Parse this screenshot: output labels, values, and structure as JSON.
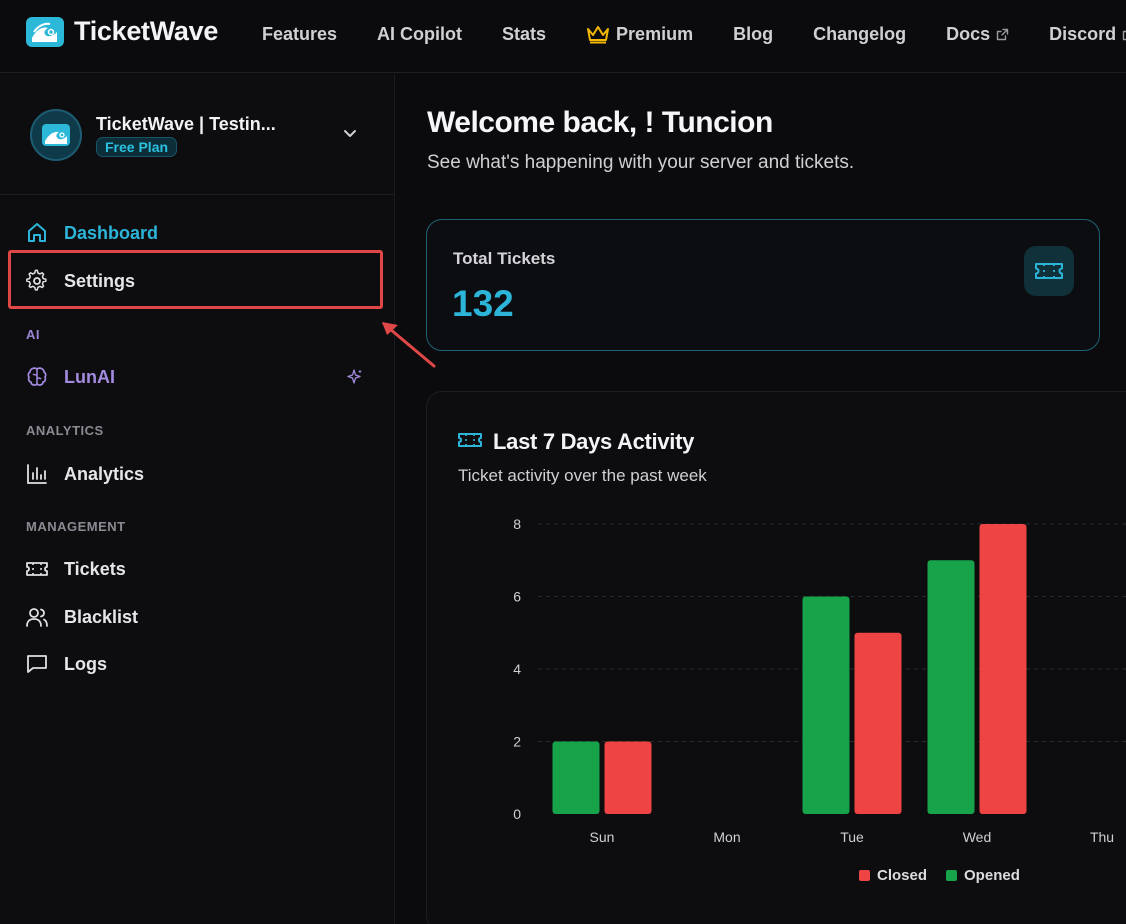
{
  "app": {
    "brand_name": "TicketWave"
  },
  "nav": {
    "links": [
      {
        "label": "Features",
        "icon": null
      },
      {
        "label": "AI Copilot",
        "icon": null
      },
      {
        "label": "Stats",
        "icon": null
      },
      {
        "label": "Premium",
        "icon": "crown-icon"
      },
      {
        "label": "Blog",
        "icon": null
      },
      {
        "label": "Changelog",
        "icon": null
      },
      {
        "label": "Docs",
        "icon": "external-link-icon"
      },
      {
        "label": "Discord",
        "icon": "external-link-icon"
      }
    ]
  },
  "sidebar": {
    "server_name": "TicketWave | Testin...",
    "plan": "Free Plan",
    "items": {
      "dashboard": "Dashboard",
      "settings": "Settings",
      "lunai": "LunAI",
      "analytics": "Analytics",
      "tickets": "Tickets",
      "blacklist": "Blacklist",
      "logs": "Logs"
    },
    "sections": {
      "ai": "AI",
      "analytics": "ANALYTICS",
      "management": "MANAGEMENT"
    }
  },
  "main": {
    "welcome": "Welcome back, ! Tuncion",
    "subtitle": "See what's happening with your server and tickets.",
    "total_tickets_label": "Total Tickets",
    "total_tickets_value": "132",
    "chart_title": "Last 7 Days Activity",
    "chart_subtitle": "Ticket activity over the past week"
  },
  "colors": {
    "accent": "#2cb5d8",
    "opened": "#16a34a",
    "closed": "#ef4444",
    "ai": "#a48be0",
    "highlight": "#e04848"
  },
  "chart_data": {
    "type": "bar",
    "categories": [
      "Sun",
      "Mon",
      "Tue",
      "Wed",
      "Thu"
    ],
    "series": [
      {
        "name": "Opened",
        "values": [
          2,
          0,
          6,
          7,
          0
        ]
      },
      {
        "name": "Closed",
        "values": [
          2,
          0,
          5,
          8,
          0
        ]
      }
    ],
    "ylim": [
      0,
      8
    ],
    "yticks": [
      0,
      2,
      4,
      6,
      8
    ],
    "grid": true,
    "legend": [
      "Closed",
      "Opened"
    ],
    "legend_placement": "bottom"
  }
}
